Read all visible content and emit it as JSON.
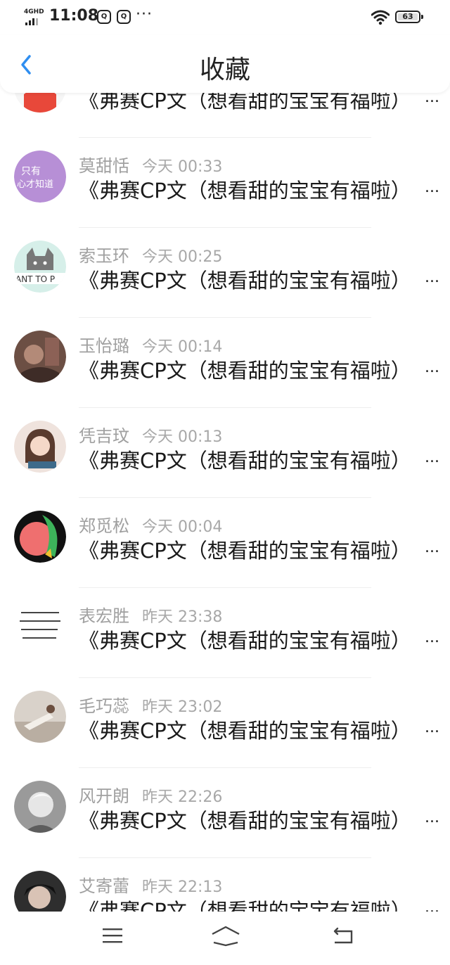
{
  "status": {
    "network": "4GHD",
    "time": "11:08",
    "app_icon_1": "qq-icon",
    "app_icon_2": "qq-icon",
    "more": "···",
    "battery": "63"
  },
  "header": {
    "title": "收藏",
    "back_icon": "chevron-left-icon"
  },
  "items": [
    {
      "name": "",
      "when": "",
      "title": "《弗赛CP文（想看甜的宝宝有福啦）",
      "avatar_color": "#e8483a",
      "avatar_text": ""
    },
    {
      "name": "莫甜恬",
      "when": "今天 00:33",
      "title": "《弗赛CP文（想看甜的宝宝有福啦）",
      "avatar_color": "#b78fd6",
      "avatar_text": "只有\n心才知道"
    },
    {
      "name": "索玉环",
      "when": "今天 00:25",
      "title": "《弗赛CP文（想看甜的宝宝有福啦）",
      "avatar_color": "#c7e6df",
      "avatar_text": "ANT TO P"
    },
    {
      "name": "玉怡璐",
      "when": "今天 00:14",
      "title": "《弗赛CP文（想看甜的宝宝有福啦）",
      "avatar_color": "#7a5a4e",
      "avatar_text": ""
    },
    {
      "name": "凭吉玟",
      "when": "今天 00:13",
      "title": "《弗赛CP文（想看甜的宝宝有福啦）",
      "avatar_color": "#e9d9d2",
      "avatar_text": ""
    },
    {
      "name": "郑觅松",
      "when": "今天 00:04",
      "title": "《弗赛CP文（想看甜的宝宝有福啦）",
      "avatar_color": "#ef6f6f",
      "avatar_text": ""
    },
    {
      "name": "表宏胜",
      "when": "昨天 23:38",
      "title": "《弗赛CP文（想看甜的宝宝有福啦）",
      "avatar_color": "#ffffff",
      "avatar_text": ""
    },
    {
      "name": "毛巧蕊",
      "when": "昨天 23:02",
      "title": "《弗赛CP文（想看甜的宝宝有福啦）",
      "avatar_color": "#cfc7be",
      "avatar_text": ""
    },
    {
      "name": "风开朗",
      "when": "昨天 22:26",
      "title": "《弗赛CP文（想看甜的宝宝有福啦）",
      "avatar_color": "#b9b9b9",
      "avatar_text": ""
    },
    {
      "name": "艾寄蕾",
      "when": "昨天 22:13",
      "title": "《弗赛CP文（想看甜的宝宝有福啦）",
      "avatar_color": "#3a3a3a",
      "avatar_text": ""
    }
  ],
  "ellipsis": "...",
  "nav": {
    "menu_icon": "menu-icon",
    "home_icon": "home-icon",
    "back_icon": "back-icon"
  },
  "colors": {
    "accent": "#2f8ef0",
    "meta_gray": "#a0a0a0",
    "text": "#1a1a1a"
  }
}
